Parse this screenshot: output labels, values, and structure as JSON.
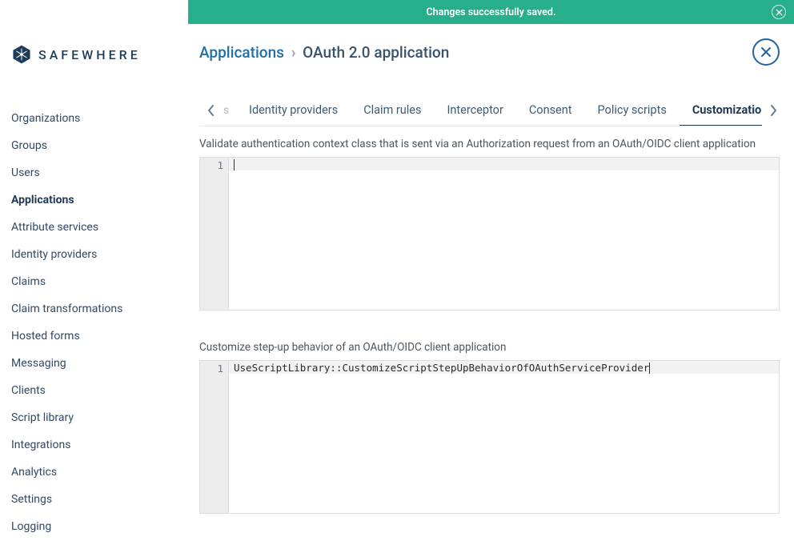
{
  "toast": {
    "message": "Changes successfully saved."
  },
  "brand": {
    "name": "SAFEWHERE"
  },
  "sidebar": {
    "items": [
      {
        "label": "Organizations",
        "selected": false
      },
      {
        "label": "Groups",
        "selected": false
      },
      {
        "label": "Users",
        "selected": false
      },
      {
        "label": "Applications",
        "selected": true
      },
      {
        "label": "Attribute services",
        "selected": false
      },
      {
        "label": "Identity providers",
        "selected": false
      },
      {
        "label": "Claims",
        "selected": false
      },
      {
        "label": "Claim transformations",
        "selected": false
      },
      {
        "label": "Hosted forms",
        "selected": false
      },
      {
        "label": "Messaging",
        "selected": false
      },
      {
        "label": "Clients",
        "selected": false
      },
      {
        "label": "Script library",
        "selected": false
      },
      {
        "label": "Integrations",
        "selected": false
      },
      {
        "label": "Analytics",
        "selected": false
      },
      {
        "label": "Settings",
        "selected": false
      },
      {
        "label": "Logging",
        "selected": false
      }
    ]
  },
  "breadcrumb": {
    "root": "Applications",
    "current": "OAuth 2.0 application"
  },
  "tabs": {
    "peek_left": "s",
    "items": [
      {
        "label": "Identity providers",
        "active": false
      },
      {
        "label": "Claim rules",
        "active": false
      },
      {
        "label": "Interceptor",
        "active": false
      },
      {
        "label": "Consent",
        "active": false
      },
      {
        "label": "Policy scripts",
        "active": false
      },
      {
        "label": "Customizations",
        "active": true
      }
    ]
  },
  "sections": {
    "validate_acr": {
      "label": "Validate authentication context class that is sent via an Authorization request from an OAuth/OIDC client application",
      "line_count": "1",
      "code": ""
    },
    "stepup": {
      "label": "Customize step-up behavior of an OAuth/OIDC client application",
      "line_count": "1",
      "code": "UseScriptLibrary::CustomizeScriptStepUpBehaviorOfOAuthServiceProvider"
    }
  }
}
